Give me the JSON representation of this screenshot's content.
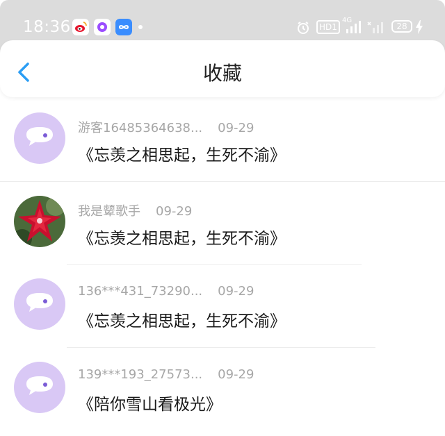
{
  "status_bar": {
    "time": "18:36",
    "battery": "28",
    "network": "4G",
    "hd_label": "HD1",
    "app_icons": [
      "weibo-icon",
      "purple-app-icon",
      "infinity-app-icon"
    ]
  },
  "header": {
    "title": "收藏",
    "back_icon": "chevron-left-icon",
    "accent_color": "#2a9df4"
  },
  "favorites": [
    {
      "user": "游客16485364638...",
      "date": "09-29",
      "title": "《忘羡之相思起，生死不渝》",
      "avatar": "default-chat-avatar"
    },
    {
      "user": "我是颦歌手",
      "date": "09-29",
      "title": "《忘羡之相思起，生死不渝》",
      "avatar": "red-flower-photo"
    },
    {
      "user": "136***431_73290...",
      "date": "09-29",
      "title": "《忘羡之相思起，生死不渝》",
      "avatar": "default-chat-avatar"
    },
    {
      "user": "139***193_27573...",
      "date": "09-29",
      "title": "《陪你雪山看极光》",
      "avatar": "default-chat-avatar"
    }
  ]
}
